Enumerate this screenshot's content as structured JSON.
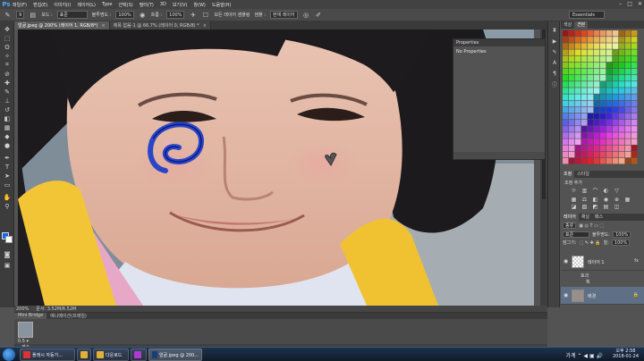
{
  "menubar": {
    "logo": "Ps",
    "items": [
      "파일(F)",
      "편집(E)",
      "이미지(I)",
      "레이어(L)",
      "Type",
      "선택(S)",
      "필터(T)",
      "3D",
      "보기(V)",
      "창(W)",
      "도움말(H)"
    ],
    "minimize": "–",
    "maximize": "□",
    "close": "✕"
  },
  "options": {
    "size": "9",
    "mode_label": "모드 :",
    "mode_value": "표준",
    "opacity_label": "불투명도 :",
    "opacity_value": "100%",
    "flow_label": "흐름 :",
    "flow_value": "100%",
    "sample_all_label": "모든 레이어 샘플링",
    "sample_label": "샘플 :",
    "sample_value": "현재 레이어",
    "workspace": "Essentials"
  },
  "tabs": [
    {
      "label": "얼굴.jpeg @ 200% (레이어 1, RGB/8*)",
      "close": "×"
    },
    {
      "label": "제목 없음-1 @ 66.7% (레이어 0, RGB/8) *",
      "close": "×"
    }
  ],
  "properties": {
    "title": "Properties",
    "body": "No Properties"
  },
  "status": {
    "zoom": "200%",
    "doc": "문서: 3.52M/6.52M"
  },
  "bridge": {
    "tabs": [
      "Mini Bridge",
      "애니메이션(프레임)"
    ],
    "thumb_name": "0.5 ▾",
    "footer": "계속"
  },
  "panels": {
    "swatch_tabs": [
      "색상",
      "견본"
    ],
    "style_tabs": [
      "조정",
      "스타일"
    ],
    "styles_title": "조정 추가",
    "layers_tabs": [
      "레이어",
      "채널",
      "패스"
    ],
    "kind_label": "종류",
    "blend_mode": "표준",
    "opacity_label": "불투명도:",
    "opacity_value": "100%",
    "lock_label": "잠그기:",
    "fill_label": "칠:",
    "fill_value": "100%",
    "layers": [
      {
        "name": "레이어 1",
        "fx": "fx"
      },
      {
        "name": "배경",
        "fx": "🔒"
      }
    ],
    "effects_label": "효과",
    "effect_item": "획"
  },
  "taskbar": {
    "buttons": [
      "플래시 자동가...",
      "",
      "다운로드",
      "",
      "얼굴.jpeg @ 200..."
    ],
    "tray_text": "가계 ⌃ ◀ ▣ 🔊",
    "time": "오후 2:58",
    "date": "2018-01-24"
  },
  "colors": {
    "foreground": "#1166ee",
    "background": "#ffffff",
    "stroke_blue": "#2a46c8",
    "panel_bg": "#535353"
  }
}
